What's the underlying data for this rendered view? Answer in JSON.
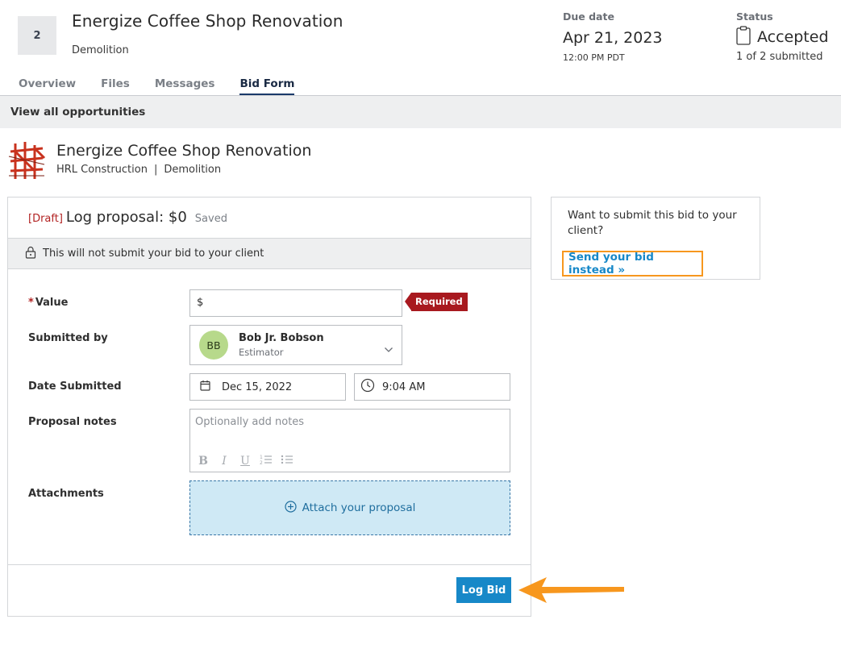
{
  "header": {
    "number": "2",
    "title": "Energize Coffee Shop Renovation",
    "subtitle": "Demolition",
    "due_label": "Due date",
    "due_date": "Apr 21, 2023",
    "due_time": "12:00 PM PDT",
    "status_label": "Status",
    "status_value": "Accepted",
    "status_count": "1 of 2 submitted"
  },
  "tabs": [
    {
      "label": "Overview",
      "active": false
    },
    {
      "label": "Files",
      "active": false
    },
    {
      "label": "Messages",
      "active": false
    },
    {
      "label": "Bid Form",
      "active": true
    }
  ],
  "banner": {
    "label": "View all opportunities"
  },
  "project": {
    "title": "Energize Coffee Shop Renovation",
    "company": "HRL Construction",
    "separator": "|",
    "trade": "Demolition"
  },
  "form": {
    "draft_tag": "[Draft]",
    "title": "Log proposal: $0",
    "saved": "Saved",
    "notice": "This will not submit your bid to your client",
    "value_star": "*",
    "value_label": "Value",
    "value_input": "$",
    "required_tag": "Required",
    "submitted_by_label": "Submitted by",
    "user_initials": "BB",
    "user_name": "Bob Jr. Bobson",
    "user_role": "Estimator",
    "date_label": "Date Submitted",
    "date_value": "Dec 15, 2022",
    "time_value": "9:04 AM",
    "notes_label": "Proposal notes",
    "notes_placeholder": "Optionally add notes",
    "toolbar": {
      "bold": "B",
      "italic": "I",
      "underline": "U"
    },
    "attachments_label": "Attachments",
    "attach_label": "Attach your proposal",
    "submit_label": "Log Bid"
  },
  "side": {
    "text": "Want to submit this bid to your client?",
    "link": "Send your bid instead »"
  },
  "colors": {
    "accent": "#1788c8",
    "required": "#a8191f",
    "highlight": "#f7971e",
    "avatar": "#b7d98b"
  }
}
